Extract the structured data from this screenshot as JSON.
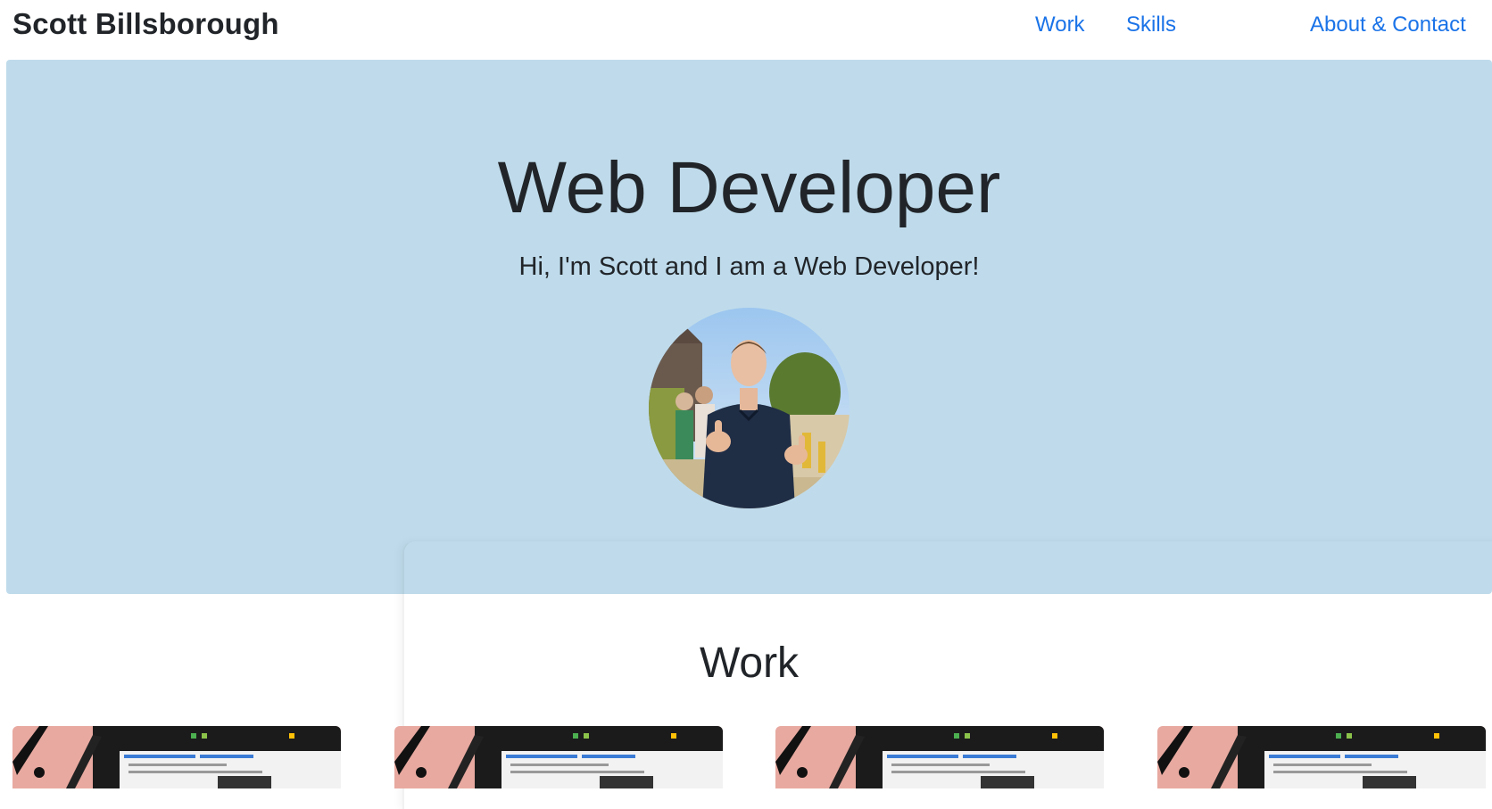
{
  "navbar": {
    "brand": "Scott Billsborough",
    "links": [
      "Work",
      "Skills",
      "About & Contact"
    ]
  },
  "hero": {
    "title": "Web Developer",
    "subtitle": "Hi, I'm Scott and I am a Web Developer!",
    "background_color": "#bfdbeb"
  },
  "work": {
    "title": "Work",
    "items_visible": 4
  },
  "colors": {
    "link": "#1a73e8",
    "text": "#212529"
  }
}
